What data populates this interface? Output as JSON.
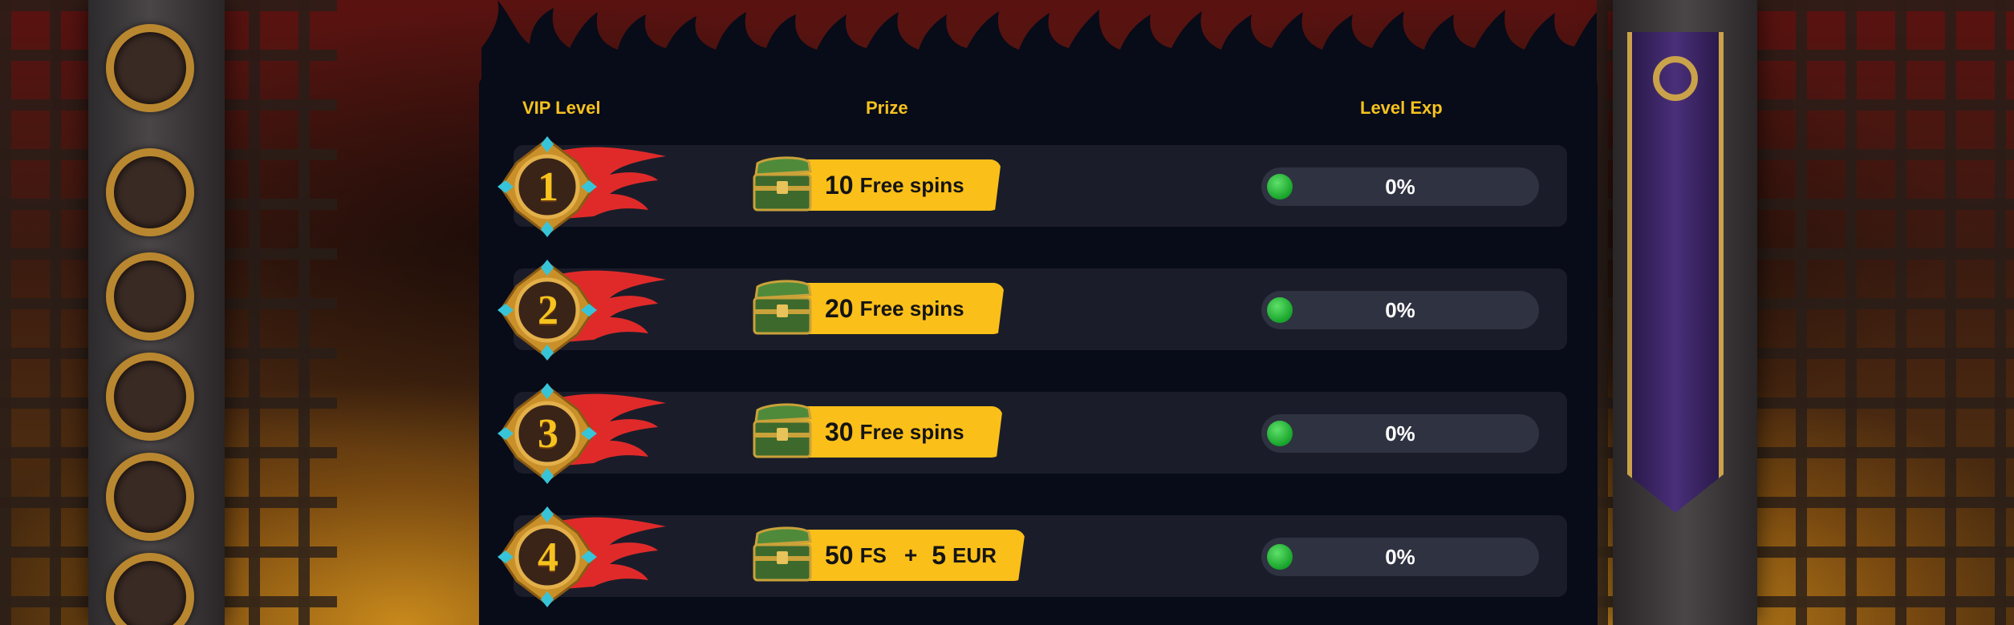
{
  "table": {
    "headers": {
      "vip_level": "VIP Level",
      "prize": "Prize",
      "level_exp": "Level Exp"
    },
    "rows": [
      {
        "level": "1",
        "prize_amount": "10",
        "prize_unit": "Free spins",
        "prize_plus": "",
        "prize_amount2": "",
        "prize_unit2": "",
        "exp_percent": "0%",
        "exp_value": 0
      },
      {
        "level": "2",
        "prize_amount": "20",
        "prize_unit": "Free spins",
        "prize_plus": "",
        "prize_amount2": "",
        "prize_unit2": "",
        "exp_percent": "0%",
        "exp_value": 0
      },
      {
        "level": "3",
        "prize_amount": "30",
        "prize_unit": "Free spins",
        "prize_plus": "",
        "prize_amount2": "",
        "prize_unit2": "",
        "exp_percent": "0%",
        "exp_value": 0
      },
      {
        "level": "4",
        "prize_amount": "50",
        "prize_unit": "FS",
        "prize_plus": "+",
        "prize_amount2": "5",
        "prize_unit2": "EUR",
        "exp_percent": "0%",
        "exp_value": 0
      }
    ]
  },
  "icons": {
    "badge": "vip-level-badge-icon",
    "flame": "flame-icon",
    "chest": "treasure-chest-icon",
    "exp_indicator": "green-dot-icon"
  },
  "colors": {
    "accent": "#f6c21e",
    "prize_pill": "#fbbf1a",
    "panel_bg": "#080b18",
    "row_bg": "#1a1d29",
    "exp_track": "#2f3241",
    "exp_dot": "#17a32a",
    "flame": "#e02a2a"
  }
}
